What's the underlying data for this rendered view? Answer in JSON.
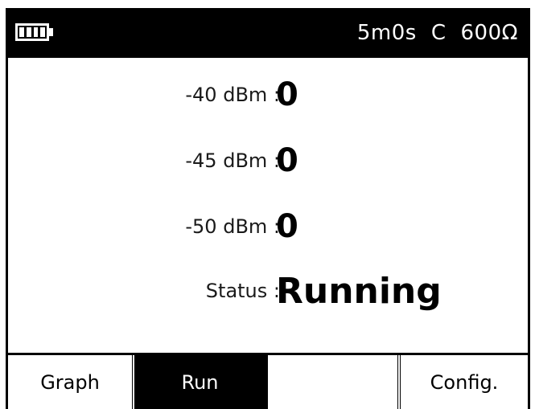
{
  "status_bar": {
    "battery_icon": "battery-full-icon",
    "timer": "5m0s",
    "mode": "C",
    "impedance": "600Ω"
  },
  "readings": [
    {
      "label": "-40 dBm :",
      "value": "0"
    },
    {
      "label": "-45 dBm :",
      "value": "0"
    },
    {
      "label": "-50 dBm :",
      "value": "0"
    }
  ],
  "status": {
    "label": "Status :",
    "value": "Running"
  },
  "tabs": [
    {
      "label": "Graph",
      "active": false
    },
    {
      "label": "Run",
      "active": true
    },
    {
      "label": "",
      "active": false
    },
    {
      "label": "Config.",
      "active": false
    }
  ]
}
